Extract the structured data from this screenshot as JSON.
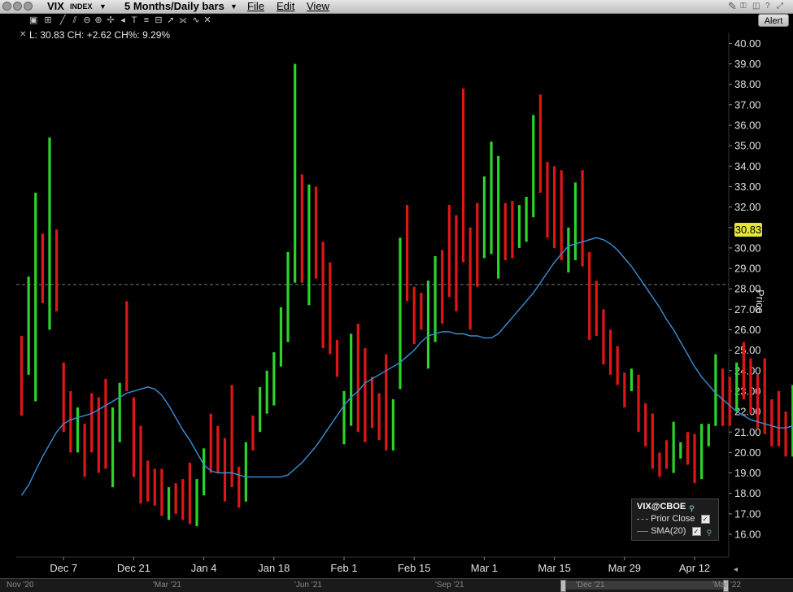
{
  "window": {
    "symbol": "VIX",
    "symbol_type": "INDEX",
    "period": "5 Months/Daily bars",
    "menu": [
      "File",
      "Edit",
      "View"
    ],
    "alert_label": "Alert"
  },
  "readout": "L: 30.83 CH: +2.62 CH%: 9.29%",
  "last_price_tag": "30.83",
  "axis_title": "Price",
  "legend": {
    "title": "VIX@CBOE",
    "items": [
      {
        "label": "Prior Close",
        "style": "dashed-grey",
        "checked": true
      },
      {
        "label": "SMA(20)",
        "style": "blue-line",
        "checked": true
      }
    ]
  },
  "navigator_labels": [
    "Nov '20",
    "'Mar '21",
    "'Jun '21",
    "'Sep '21",
    "'Dec '21",
    "'Mar '22"
  ],
  "colors": {
    "up": "#2bd42b",
    "down": "#e01616",
    "sma": "#3a8fd8",
    "prior_close": "#777777",
    "last_tag": "#e6e63a"
  },
  "chart_data": {
    "type": "ohlc-bar",
    "title": "VIX INDEX 5 Months/Daily bars",
    "ylabel": "Price",
    "ylim": [
      15.1,
      40.9
    ],
    "y_ticks": [
      "16.00",
      "17.00",
      "18.00",
      "19.00",
      "20.00",
      "21.00",
      "22.00",
      "23.00",
      "24.00",
      "25.00",
      "26.00",
      "27.00",
      "28.00",
      "29.00",
      "30.00",
      "31.00",
      "32.00",
      "33.00",
      "34.00",
      "35.00",
      "36.00",
      "37.00",
      "38.00",
      "39.00",
      "40.00"
    ],
    "x_tick_labels": [
      "Dec 7",
      "Dec 21",
      "Jan 4",
      "Jan 18",
      "Feb 1",
      "Feb 15",
      "Mar 1",
      "Mar 15",
      "Mar 29",
      "Apr 12"
    ],
    "x_tick_index": [
      6,
      16,
      26,
      36,
      46,
      56,
      66,
      76,
      86,
      96
    ],
    "prior_close": 28.21,
    "last": 30.83,
    "bars": [
      {
        "low": 21.8,
        "high": 25.7,
        "dir": "down"
      },
      {
        "low": 23.8,
        "high": 28.6,
        "dir": "up"
      },
      {
        "low": 22.5,
        "high": 32.7,
        "dir": "up"
      },
      {
        "low": 27.3,
        "high": 30.7,
        "dir": "down"
      },
      {
        "low": 26.0,
        "high": 35.4,
        "dir": "up"
      },
      {
        "low": 26.9,
        "high": 30.9,
        "dir": "down"
      },
      {
        "low": 21.0,
        "high": 24.4,
        "dir": "down"
      },
      {
        "low": 20.0,
        "high": 23.0,
        "dir": "down"
      },
      {
        "low": 20.0,
        "high": 22.2,
        "dir": "up"
      },
      {
        "low": 18.8,
        "high": 21.4,
        "dir": "down"
      },
      {
        "low": 20.0,
        "high": 22.9,
        "dir": "down"
      },
      {
        "low": 19.0,
        "high": 22.7,
        "dir": "down"
      },
      {
        "low": 19.2,
        "high": 23.6,
        "dir": "down"
      },
      {
        "low": 18.3,
        "high": 22.2,
        "dir": "up"
      },
      {
        "low": 20.5,
        "high": 23.4,
        "dir": "up"
      },
      {
        "low": 23.0,
        "high": 27.4,
        "dir": "down"
      },
      {
        "low": 18.8,
        "high": 22.7,
        "dir": "down"
      },
      {
        "low": 17.5,
        "high": 21.3,
        "dir": "down"
      },
      {
        "low": 17.6,
        "high": 19.6,
        "dir": "down"
      },
      {
        "low": 17.4,
        "high": 19.2,
        "dir": "down"
      },
      {
        "low": 16.9,
        "high": 19.2,
        "dir": "down"
      },
      {
        "low": 16.7,
        "high": 18.3,
        "dir": "up"
      },
      {
        "low": 17.0,
        "high": 18.5,
        "dir": "down"
      },
      {
        "low": 16.7,
        "high": 18.7,
        "dir": "down"
      },
      {
        "low": 16.5,
        "high": 19.5,
        "dir": "down"
      },
      {
        "low": 16.4,
        "high": 18.7,
        "dir": "up"
      },
      {
        "low": 17.9,
        "high": 20.2,
        "dir": "up"
      },
      {
        "low": 19.0,
        "high": 21.9,
        "dir": "down"
      },
      {
        "low": 19.0,
        "high": 21.3,
        "dir": "down"
      },
      {
        "low": 17.6,
        "high": 20.7,
        "dir": "down"
      },
      {
        "low": 18.3,
        "high": 23.3,
        "dir": "down"
      },
      {
        "low": 17.3,
        "high": 19.3,
        "dir": "down"
      },
      {
        "low": 17.6,
        "high": 20.5,
        "dir": "up"
      },
      {
        "low": 20.1,
        "high": 21.8,
        "dir": "down"
      },
      {
        "low": 21.0,
        "high": 23.2,
        "dir": "up"
      },
      {
        "low": 21.9,
        "high": 24.0,
        "dir": "up"
      },
      {
        "low": 22.3,
        "high": 24.9,
        "dir": "up"
      },
      {
        "low": 24.2,
        "high": 27.1,
        "dir": "up"
      },
      {
        "low": 25.4,
        "high": 29.8,
        "dir": "up"
      },
      {
        "low": 28.3,
        "high": 39.0,
        "dir": "up"
      },
      {
        "low": 28.3,
        "high": 33.6,
        "dir": "down"
      },
      {
        "low": 27.2,
        "high": 33.1,
        "dir": "up"
      },
      {
        "low": 28.5,
        "high": 33.0,
        "dir": "down"
      },
      {
        "low": 25.1,
        "high": 30.3,
        "dir": "down"
      },
      {
        "low": 24.8,
        "high": 29.3,
        "dir": "down"
      },
      {
        "low": 23.7,
        "high": 25.5,
        "dir": "down"
      },
      {
        "low": 20.4,
        "high": 23.0,
        "dir": "up"
      },
      {
        "low": 21.3,
        "high": 25.8,
        "dir": "up"
      },
      {
        "low": 21.0,
        "high": 26.3,
        "dir": "down"
      },
      {
        "low": 20.5,
        "high": 25.1,
        "dir": "down"
      },
      {
        "low": 21.2,
        "high": 23.7,
        "dir": "down"
      },
      {
        "low": 20.6,
        "high": 22.9,
        "dir": "down"
      },
      {
        "low": 20.1,
        "high": 24.8,
        "dir": "down"
      },
      {
        "low": 20.1,
        "high": 22.6,
        "dir": "up"
      },
      {
        "low": 23.1,
        "high": 30.5,
        "dir": "up"
      },
      {
        "low": 27.4,
        "high": 32.1,
        "dir": "down"
      },
      {
        "low": 25.3,
        "high": 28.1,
        "dir": "down"
      },
      {
        "low": 26.0,
        "high": 27.8,
        "dir": "down"
      },
      {
        "low": 24.1,
        "high": 28.4,
        "dir": "up"
      },
      {
        "low": 25.4,
        "high": 29.6,
        "dir": "up"
      },
      {
        "low": 26.3,
        "high": 29.9,
        "dir": "down"
      },
      {
        "low": 27.6,
        "high": 32.1,
        "dir": "down"
      },
      {
        "low": 26.9,
        "high": 31.6,
        "dir": "down"
      },
      {
        "low": 29.3,
        "high": 37.8,
        "dir": "down"
      },
      {
        "low": 26.0,
        "high": 31.0,
        "dir": "down"
      },
      {
        "low": 28.1,
        "high": 32.2,
        "dir": "down"
      },
      {
        "low": 29.5,
        "high": 33.5,
        "dir": "up"
      },
      {
        "low": 29.7,
        "high": 35.2,
        "dir": "up"
      },
      {
        "low": 28.5,
        "high": 34.5,
        "dir": "up"
      },
      {
        "low": 29.4,
        "high": 32.2,
        "dir": "down"
      },
      {
        "low": 29.5,
        "high": 32.3,
        "dir": "down"
      },
      {
        "low": 30.0,
        "high": 32.1,
        "dir": "up"
      },
      {
        "low": 30.3,
        "high": 32.5,
        "dir": "up"
      },
      {
        "low": 31.5,
        "high": 36.5,
        "dir": "up"
      },
      {
        "low": 32.7,
        "high": 37.5,
        "dir": "down"
      },
      {
        "low": 30.5,
        "high": 34.2,
        "dir": "down"
      },
      {
        "low": 30.0,
        "high": 34.0,
        "dir": "down"
      },
      {
        "low": 29.4,
        "high": 33.8,
        "dir": "down"
      },
      {
        "low": 28.8,
        "high": 31.0,
        "dir": "up"
      },
      {
        "low": 29.4,
        "high": 33.2,
        "dir": "up"
      },
      {
        "low": 29.1,
        "high": 33.8,
        "dir": "down"
      },
      {
        "low": 25.5,
        "high": 29.8,
        "dir": "down"
      },
      {
        "low": 25.7,
        "high": 28.4,
        "dir": "down"
      },
      {
        "low": 24.3,
        "high": 27.0,
        "dir": "down"
      },
      {
        "low": 23.8,
        "high": 26.0,
        "dir": "down"
      },
      {
        "low": 23.3,
        "high": 25.2,
        "dir": "down"
      },
      {
        "low": 22.2,
        "high": 23.9,
        "dir": "down"
      },
      {
        "low": 23.0,
        "high": 24.1,
        "dir": "up"
      },
      {
        "low": 21.0,
        "high": 23.8,
        "dir": "down"
      },
      {
        "low": 20.3,
        "high": 22.4,
        "dir": "down"
      },
      {
        "low": 19.2,
        "high": 21.9,
        "dir": "down"
      },
      {
        "low": 18.8,
        "high": 20.0,
        "dir": "down"
      },
      {
        "low": 19.2,
        "high": 20.6,
        "dir": "down"
      },
      {
        "low": 19.0,
        "high": 21.5,
        "dir": "up"
      },
      {
        "low": 19.7,
        "high": 20.5,
        "dir": "up"
      },
      {
        "low": 19.4,
        "high": 21.0,
        "dir": "down"
      },
      {
        "low": 18.5,
        "high": 20.9,
        "dir": "down"
      },
      {
        "low": 18.7,
        "high": 21.4,
        "dir": "up"
      },
      {
        "low": 20.3,
        "high": 21.4,
        "dir": "up"
      },
      {
        "low": 21.3,
        "high": 24.8,
        "dir": "up"
      },
      {
        "low": 21.3,
        "high": 24.1,
        "dir": "down"
      },
      {
        "low": 21.3,
        "high": 23.7,
        "dir": "down"
      },
      {
        "low": 22.0,
        "high": 24.4,
        "dir": "up"
      },
      {
        "low": 22.6,
        "high": 25.4,
        "dir": "down"
      },
      {
        "low": 21.9,
        "high": 24.6,
        "dir": "down"
      },
      {
        "low": 21.2,
        "high": 23.8,
        "dir": "down"
      },
      {
        "low": 20.9,
        "high": 24.6,
        "dir": "down"
      },
      {
        "low": 20.3,
        "high": 22.6,
        "dir": "down"
      },
      {
        "low": 20.3,
        "high": 23.0,
        "dir": "down"
      },
      {
        "low": 19.8,
        "high": 22.0,
        "dir": "down"
      },
      {
        "low": 19.8,
        "high": 23.3,
        "dir": "up"
      },
      {
        "low": 22.6,
        "high": 28.3,
        "dir": "up"
      },
      {
        "low": 29.1,
        "high": 31.0,
        "dir": "up"
      }
    ],
    "series": [
      {
        "name": "SMA(20)",
        "values": [
          17.9,
          18.4,
          19.1,
          19.8,
          20.4,
          21.0,
          21.4,
          21.6,
          21.7,
          21.8,
          21.9,
          22.1,
          22.3,
          22.5,
          22.7,
          22.9,
          23.0,
          23.1,
          23.2,
          23.1,
          22.8,
          22.3,
          21.7,
          21.1,
          20.6,
          20.0,
          19.4,
          19.1,
          19.0,
          19.0,
          19.0,
          18.9,
          18.8,
          18.8,
          18.8,
          18.8,
          18.8,
          18.8,
          18.9,
          19.2,
          19.5,
          19.9,
          20.3,
          20.8,
          21.3,
          21.8,
          22.3,
          22.7,
          23.0,
          23.4,
          23.6,
          23.8,
          24.0,
          24.2,
          24.4,
          24.7,
          25.0,
          25.4,
          25.7,
          25.8,
          25.9,
          25.9,
          25.8,
          25.8,
          25.7,
          25.7,
          25.6,
          25.6,
          25.8,
          26.2,
          26.6,
          27.0,
          27.4,
          27.8,
          28.3,
          28.8,
          29.3,
          29.7,
          30.1,
          30.2,
          30.3,
          30.4,
          30.5,
          30.4,
          30.2,
          29.9,
          29.5,
          29.1,
          28.6,
          28.1,
          27.6,
          27.1,
          26.5,
          26.0,
          25.4,
          24.8,
          24.2,
          23.7,
          23.3,
          22.9,
          22.6,
          22.3,
          22.0,
          21.8,
          21.6,
          21.5,
          21.4,
          21.3,
          21.2,
          21.2,
          21.3,
          21.6,
          22.0
        ]
      }
    ]
  }
}
